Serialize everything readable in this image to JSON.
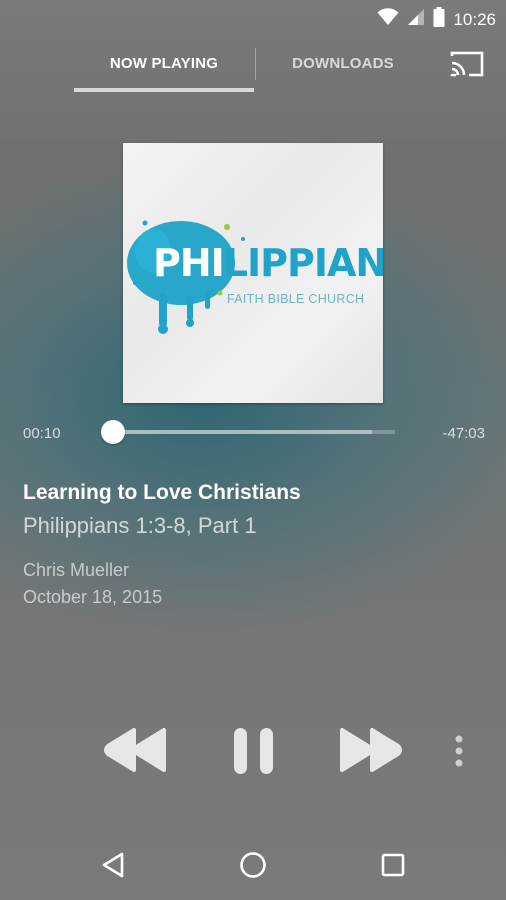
{
  "status_bar": {
    "time": "10:26"
  },
  "tabs": [
    {
      "label": "NOW PLAYING",
      "active": true
    },
    {
      "label": "DOWNLOADS",
      "active": false
    }
  ],
  "artwork": {
    "title_highlight": "PHI",
    "title_rest": "LIPPIANS",
    "subtitle": "FAITH BIBLE CHURCH"
  },
  "player": {
    "elapsed": "00:10",
    "remaining": "-47:03",
    "progress_fraction": 0.004,
    "buffer_fraction": 0.92
  },
  "track": {
    "title": "Learning to Love Christians",
    "subtitle": "Philippians 1:3-8, Part 1",
    "speaker": "Chris Mueller",
    "date": "October 18, 2015"
  },
  "icons": {
    "status": [
      "wifi-icon",
      "signal-icon",
      "battery-icon"
    ],
    "toolbar": [
      "cast-icon"
    ],
    "controls": [
      "rewind-icon",
      "pause-icon",
      "fast-forward-icon",
      "more-vertical-icon"
    ],
    "navigation": [
      "back-icon",
      "home-icon",
      "recents-icon"
    ]
  },
  "colors": {
    "accent_blue": "#1fa3c9",
    "background_teal": "#2c6673",
    "background_gray": "#7a7a7a"
  }
}
